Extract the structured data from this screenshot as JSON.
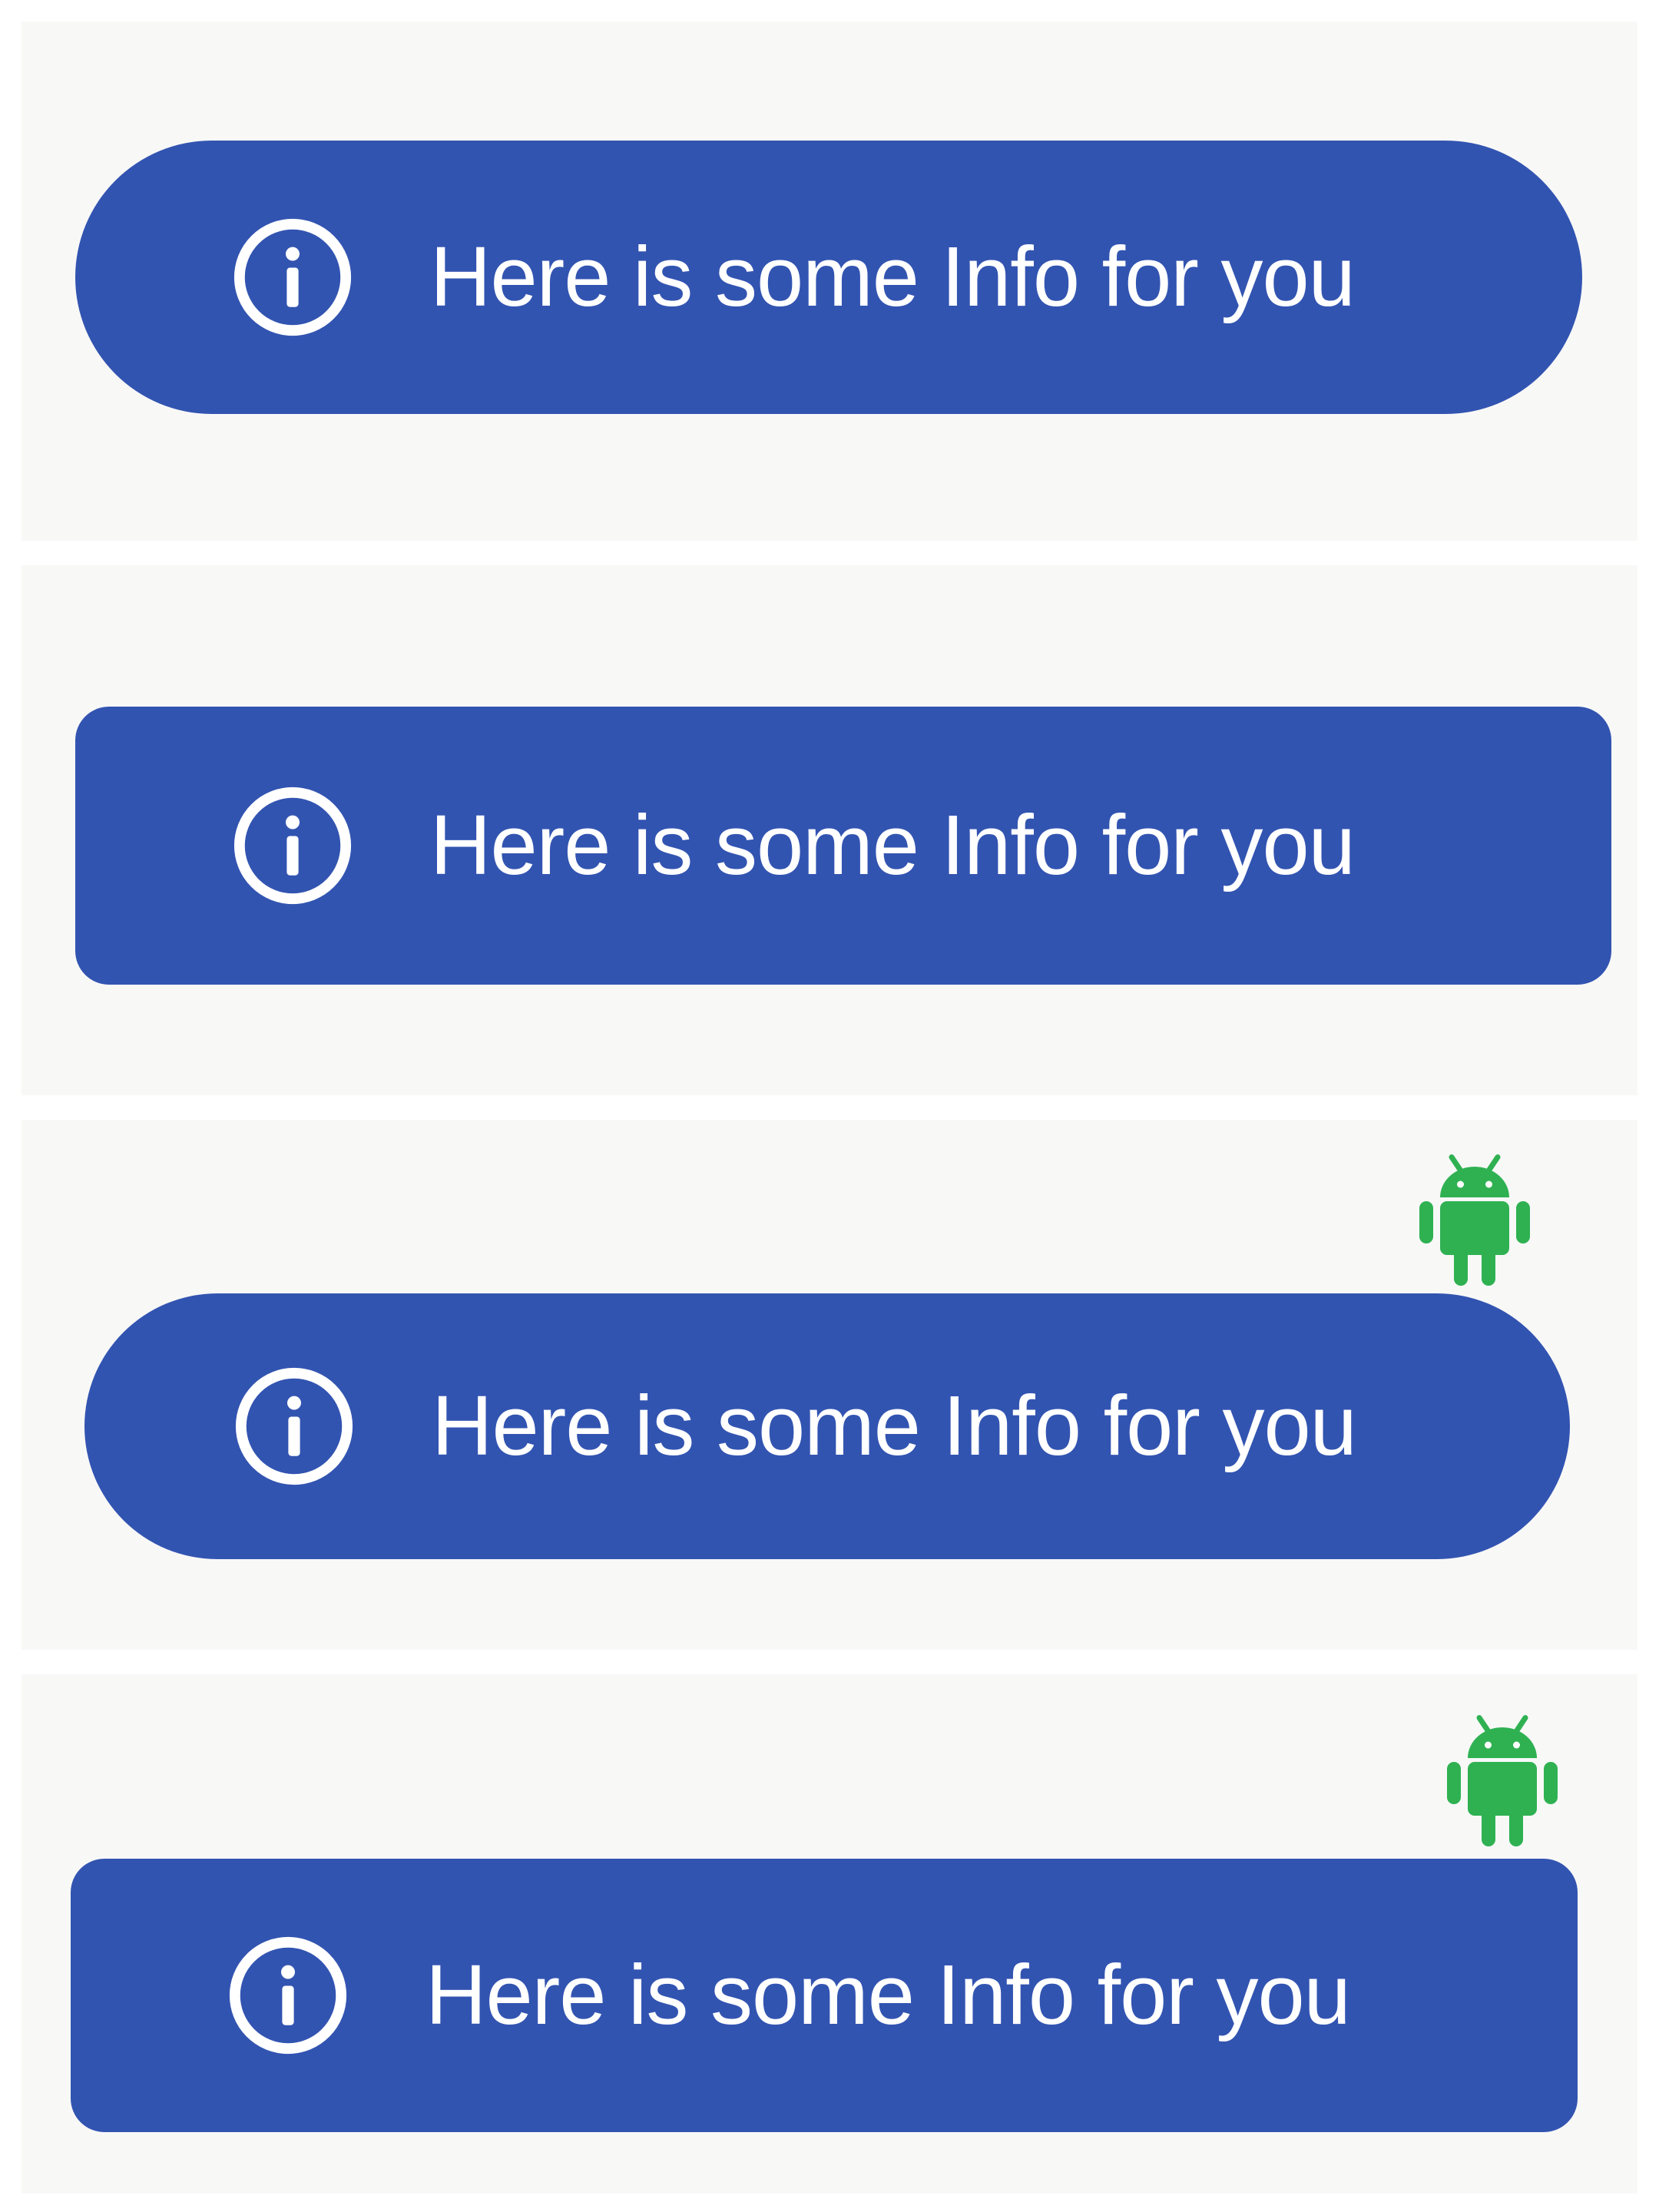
{
  "colors": {
    "pill_background": "#3254b1",
    "pill_text": "#ffffff",
    "panel_background": "#f8f8f7",
    "page_background": "#ffffff",
    "android_green": "#2fb152"
  },
  "icons": {
    "info": "info-circle-icon",
    "badge": "android-icon"
  },
  "variants": [
    {
      "message": "Here is some Info for you",
      "shape": "fully-rounded",
      "badge": false
    },
    {
      "message": "Here is some Info for you",
      "shape": "slightly-rounded",
      "badge": false
    },
    {
      "message": "Here is some Info for you",
      "shape": "fully-rounded",
      "badge": true
    },
    {
      "message": "Here is some Info for you",
      "shape": "slightly-rounded",
      "badge": true
    }
  ]
}
